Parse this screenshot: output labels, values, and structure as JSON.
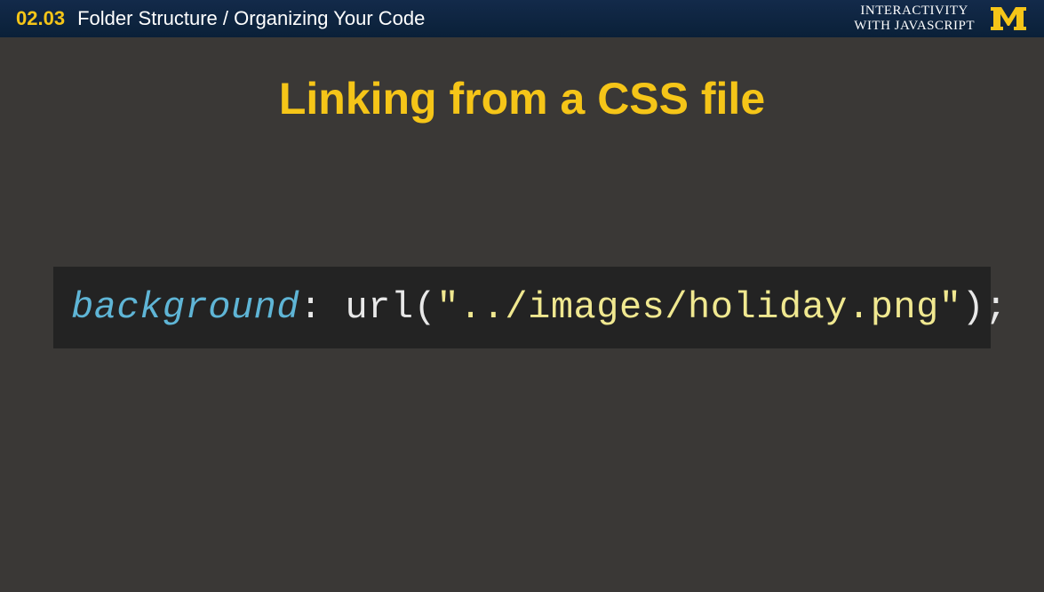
{
  "header": {
    "lesson_number": "02.03",
    "lesson_title": "Folder Structure / Organizing Your Code",
    "course_line1": "INTERACTIVITY",
    "course_line2": "WITH JAVASCRIPT"
  },
  "slide": {
    "title": "Linking from a CSS file"
  },
  "code": {
    "property": "background",
    "colon": ": ",
    "func": "url",
    "open_paren": "(",
    "string": "\"../images/holiday.png\"",
    "close_paren": ")",
    "semi": ";"
  }
}
